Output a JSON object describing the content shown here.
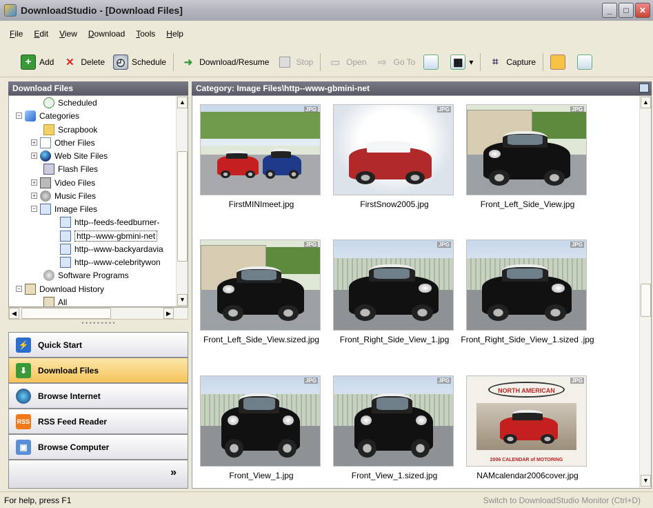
{
  "window": {
    "title": "DownloadStudio - [Download Files]"
  },
  "menu": [
    {
      "label": "File",
      "u": "F",
      "rest": "ile"
    },
    {
      "label": "Edit",
      "u": "E",
      "rest": "dit"
    },
    {
      "label": "View",
      "u": "V",
      "rest": "iew"
    },
    {
      "label": "Download",
      "u": "D",
      "rest": "ownload"
    },
    {
      "label": "Tools",
      "u": "T",
      "rest": "ools"
    },
    {
      "label": "Help",
      "u": "H",
      "rest": "elp"
    }
  ],
  "toolbar": {
    "add": "Add",
    "delete": "Delete",
    "schedule": "Schedule",
    "download_resume": "Download/Resume",
    "stop": "Stop",
    "open": "Open",
    "go_to": "Go To",
    "capture": "Capture"
  },
  "left": {
    "header": "Download Files",
    "tree": [
      {
        "label": "Scheduled",
        "icon": "clock-icon"
      },
      {
        "label": "Categories",
        "icon": "categories-icon"
      },
      {
        "label": "Scrapbook",
        "icon": "scrapbook-icon"
      },
      {
        "label": "Other Files",
        "icon": "document-icon"
      },
      {
        "label": "Web Site Files",
        "icon": "globe-icon"
      },
      {
        "label": "Flash Files",
        "icon": "flash-icon"
      },
      {
        "label": "Video Files",
        "icon": "video-icon"
      },
      {
        "label": "Music Files",
        "icon": "music-icon"
      },
      {
        "label": "Image Files",
        "icon": "image-icon"
      },
      {
        "label": "http--feeds-feedburner-",
        "icon": "image-icon"
      },
      {
        "label": "http--www-gbmini-net",
        "icon": "image-icon"
      },
      {
        "label": "http--www-backyardavia",
        "icon": "image-icon"
      },
      {
        "label": "http--www-celebritywon",
        "icon": "image-icon"
      },
      {
        "label": "Software Programs",
        "icon": "software-icon"
      },
      {
        "label": "Download History",
        "icon": "history-icon"
      },
      {
        "label": "All",
        "icon": "history-icon"
      }
    ],
    "nav": [
      {
        "label": "Quick Start",
        "icon": "lightning-icon"
      },
      {
        "label": "Download Files",
        "icon": "download-icon"
      },
      {
        "label": "Browse Internet",
        "icon": "browser-icon"
      },
      {
        "label": "RSS Feed Reader",
        "icon": "rss-icon",
        "icon_text": "RSS"
      },
      {
        "label": "Browse Computer",
        "icon": "computer-icon"
      }
    ],
    "more_glyph": "»"
  },
  "right": {
    "header": "Category: Image Files\\http--www-gbmini-net",
    "badge": "JPG",
    "thumbnails": [
      {
        "caption": "FirstMINImeet.jpg"
      },
      {
        "caption": "FirstSnow2005.jpg"
      },
      {
        "caption": "Front_Left_Side_View.jpg"
      },
      {
        "caption": "Front_Left_Side_View.sized.jpg"
      },
      {
        "caption": "Front_Right_Side_View_1.jpg"
      },
      {
        "caption": "Front_Right_Side_View_1.sized .jpg"
      },
      {
        "caption": "Front_View_1.jpg"
      },
      {
        "caption": "Front_View_1.sized.jpg"
      },
      {
        "caption": "NAMcalendar2006cover.jpg"
      }
    ],
    "calendar": {
      "logo": "NORTH AMERICAN MOTORING.COM",
      "footer": "2006 CALENDAR of MOTORING"
    }
  },
  "status": {
    "left": "For help, press F1",
    "right": "Switch to DownloadStudio Monitor (Ctrl+D)"
  }
}
